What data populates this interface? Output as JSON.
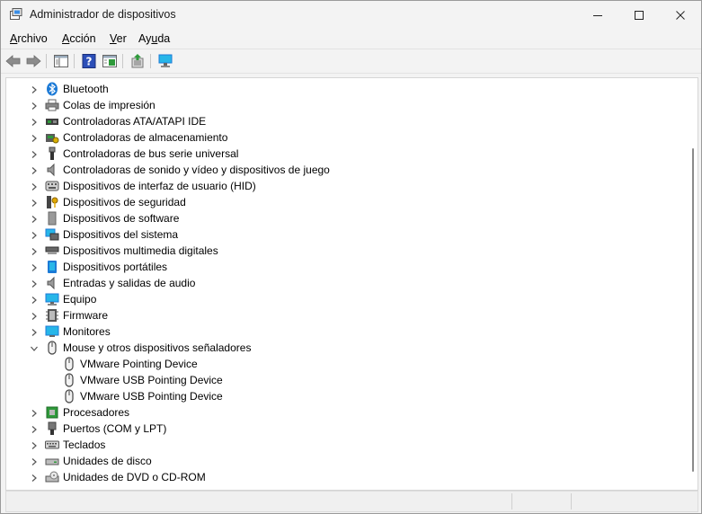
{
  "window": {
    "title": "Administrador de dispositivos"
  },
  "menu": [
    {
      "id": "archivo",
      "pre": "",
      "key": "A",
      "post": "rchivo"
    },
    {
      "id": "accion",
      "pre": "",
      "key": "A",
      "post": "cción"
    },
    {
      "id": "ver",
      "pre": "",
      "key": "V",
      "post": "er"
    },
    {
      "id": "ayuda",
      "pre": "Ay",
      "key": "u",
      "post": "da"
    }
  ],
  "toolbar": [
    "back-arrow-icon",
    "forward-arrow-icon",
    "show-hide-console-tree-icon",
    "help-icon",
    "properties-icon",
    "update-driver-icon",
    "scan-hardware-icon"
  ],
  "tree": [
    {
      "label": "Bluetooth",
      "icon": "bluetooth-icon",
      "level": 0,
      "expanded": false
    },
    {
      "label": "Colas de impresión",
      "icon": "printer-icon",
      "level": 0,
      "expanded": false
    },
    {
      "label": "Controladoras ATA/ATAPI IDE",
      "icon": "ide-controller-icon",
      "level": 0,
      "expanded": false
    },
    {
      "label": "Controladoras de almacenamiento",
      "icon": "storage-controller-icon",
      "level": 0,
      "expanded": false
    },
    {
      "label": "Controladoras de bus serie universal",
      "icon": "usb-icon",
      "level": 0,
      "expanded": false
    },
    {
      "label": "Controladoras de sonido y vídeo y dispositivos de juego",
      "icon": "speaker-icon",
      "level": 0,
      "expanded": false
    },
    {
      "label": "Dispositivos de interfaz de usuario (HID)",
      "icon": "hid-icon",
      "level": 0,
      "expanded": false
    },
    {
      "label": "Dispositivos de seguridad",
      "icon": "security-key-icon",
      "level": 0,
      "expanded": false
    },
    {
      "label": "Dispositivos de software",
      "icon": "software-device-icon",
      "level": 0,
      "expanded": false
    },
    {
      "label": "Dispositivos del sistema",
      "icon": "system-device-icon",
      "level": 0,
      "expanded": false
    },
    {
      "label": "Dispositivos multimedia digitales",
      "icon": "multimedia-device-icon",
      "level": 0,
      "expanded": false
    },
    {
      "label": "Dispositivos portátiles",
      "icon": "portable-device-icon",
      "level": 0,
      "expanded": false
    },
    {
      "label": "Entradas y salidas de audio",
      "icon": "audio-io-icon",
      "level": 0,
      "expanded": false
    },
    {
      "label": "Equipo",
      "icon": "computer-icon",
      "level": 0,
      "expanded": false
    },
    {
      "label": "Firmware",
      "icon": "firmware-icon",
      "level": 0,
      "expanded": false
    },
    {
      "label": "Monitores",
      "icon": "monitor-icon",
      "level": 0,
      "expanded": false
    },
    {
      "label": "Mouse y otros dispositivos señaladores",
      "icon": "mouse-icon",
      "level": 0,
      "expanded": true
    },
    {
      "label": "VMware Pointing Device",
      "icon": "mouse-icon",
      "level": 1
    },
    {
      "label": "VMware USB Pointing Device",
      "icon": "mouse-icon",
      "level": 1
    },
    {
      "label": "VMware USB Pointing Device",
      "icon": "mouse-icon",
      "level": 1
    },
    {
      "label": "Procesadores",
      "icon": "processor-icon",
      "level": 0,
      "expanded": false
    },
    {
      "label": "Puertos (COM y LPT)",
      "icon": "port-icon",
      "level": 0,
      "expanded": false
    },
    {
      "label": "Teclados",
      "icon": "keyboard-icon",
      "level": 0,
      "expanded": false
    },
    {
      "label": "Unidades de disco",
      "icon": "disk-drive-icon",
      "level": 0,
      "expanded": false
    },
    {
      "label": "Unidades de DVD o CD-ROM",
      "icon": "dvd-drive-icon",
      "level": 0,
      "expanded": false
    }
  ],
  "colors": {
    "accent_blue": "#1c7ad6",
    "cyan": "#27b6e8",
    "green": "#2e9a3a",
    "chevron": "#555555"
  }
}
